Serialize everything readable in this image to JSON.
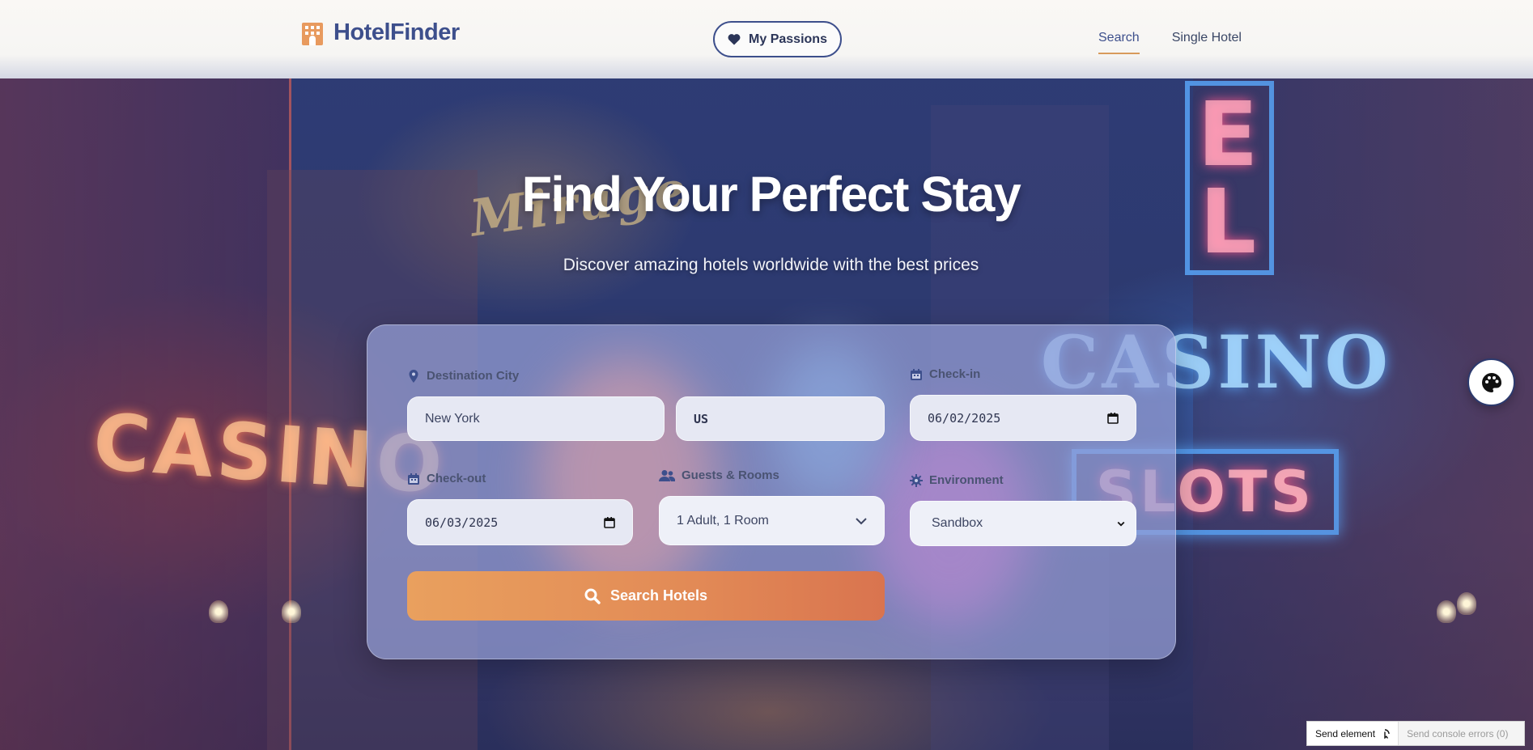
{
  "brand": {
    "name": "HotelFinder"
  },
  "header": {
    "passions_label": "My Passions",
    "nav": [
      {
        "label": "Search",
        "active": true
      },
      {
        "label": "Single Hotel",
        "active": false
      }
    ]
  },
  "hero": {
    "title": "Find Your Perfect Stay",
    "subtitle": "Discover amazing hotels worldwide with the best prices"
  },
  "background_signs": {
    "left": "CASINO",
    "right": "CASINO",
    "slots": "SLOTS",
    "mirage": "Mirage",
    "vertical": "EL"
  },
  "search_form": {
    "destination": {
      "label": "Destination City",
      "value": "New York",
      "country": "US"
    },
    "checkin": {
      "label": "Check-in",
      "value": "06/02/2025"
    },
    "checkout": {
      "label": "Check-out",
      "value": "06/03/2025"
    },
    "guests": {
      "label": "Guests & Rooms",
      "value": "1 Adult, 1 Room"
    },
    "environment": {
      "label": "Environment",
      "value": "Sandbox"
    },
    "submit_label": "Search Hotels"
  },
  "debug": {
    "send_element": "Send element",
    "console_errors": "Send console errors (0)"
  },
  "colors": {
    "brand": "#3d4f8c",
    "accent": "#e28a56",
    "card": "#96a0d7"
  }
}
